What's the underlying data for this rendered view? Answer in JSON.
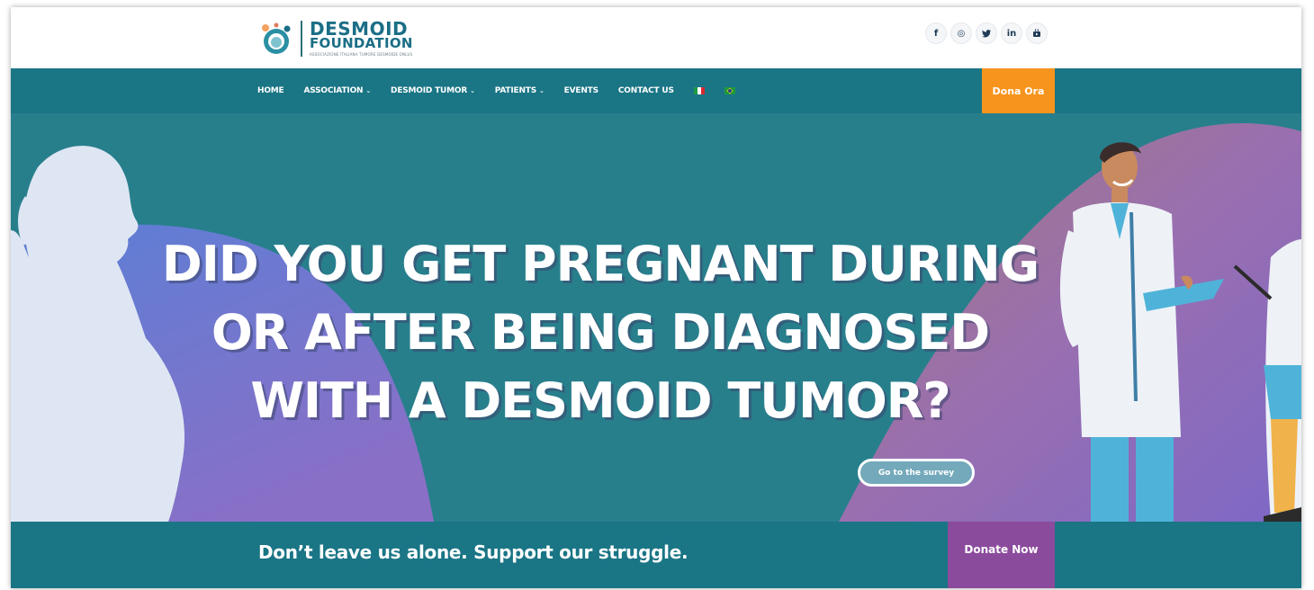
{
  "header": {
    "logo": {
      "line1": "DESMOID",
      "line2": "FOUNDATION",
      "line3": "ASSOCIAZIONE ITALIANA TUMORE DESMOIDE ONLUS"
    },
    "socials": [
      {
        "icon": "facebook-icon",
        "glyph": "f"
      },
      {
        "icon": "instagram-icon",
        "glyph": "◎"
      },
      {
        "icon": "twitter-icon",
        "glyph": "🐦"
      },
      {
        "icon": "linkedin-icon",
        "glyph": "in"
      },
      {
        "icon": "youtube-icon",
        "glyph": "▶"
      }
    ]
  },
  "nav": {
    "items": [
      {
        "label": "HOME",
        "dropdown": false
      },
      {
        "label": "ASSOCIATION",
        "dropdown": true
      },
      {
        "label": "DESMOID TUMOR",
        "dropdown": true
      },
      {
        "label": "PATIENTS",
        "dropdown": true
      },
      {
        "label": "EVENTS",
        "dropdown": false
      },
      {
        "label": "CONTACT US",
        "dropdown": false
      }
    ],
    "chevron": "⌄",
    "languages": [
      "italian-flag-icon",
      "brazil-flag-icon"
    ],
    "cta_label": "Dona Ora",
    "cta_color": "#f7941d"
  },
  "hero": {
    "headline_line1": "DID YOU GET PREGNANT DURING",
    "headline_line2": "OR AFTER BEING DIAGNOSED",
    "headline_line3": "WITH A DESMOID TUMOR?",
    "button_label": "Go to the survey",
    "background_color": "#287f8c"
  },
  "band": {
    "text": "Don’t leave us alone. Support our struggle.",
    "donate_label": "Donate Now",
    "donate_color": "#8b4b9d"
  }
}
